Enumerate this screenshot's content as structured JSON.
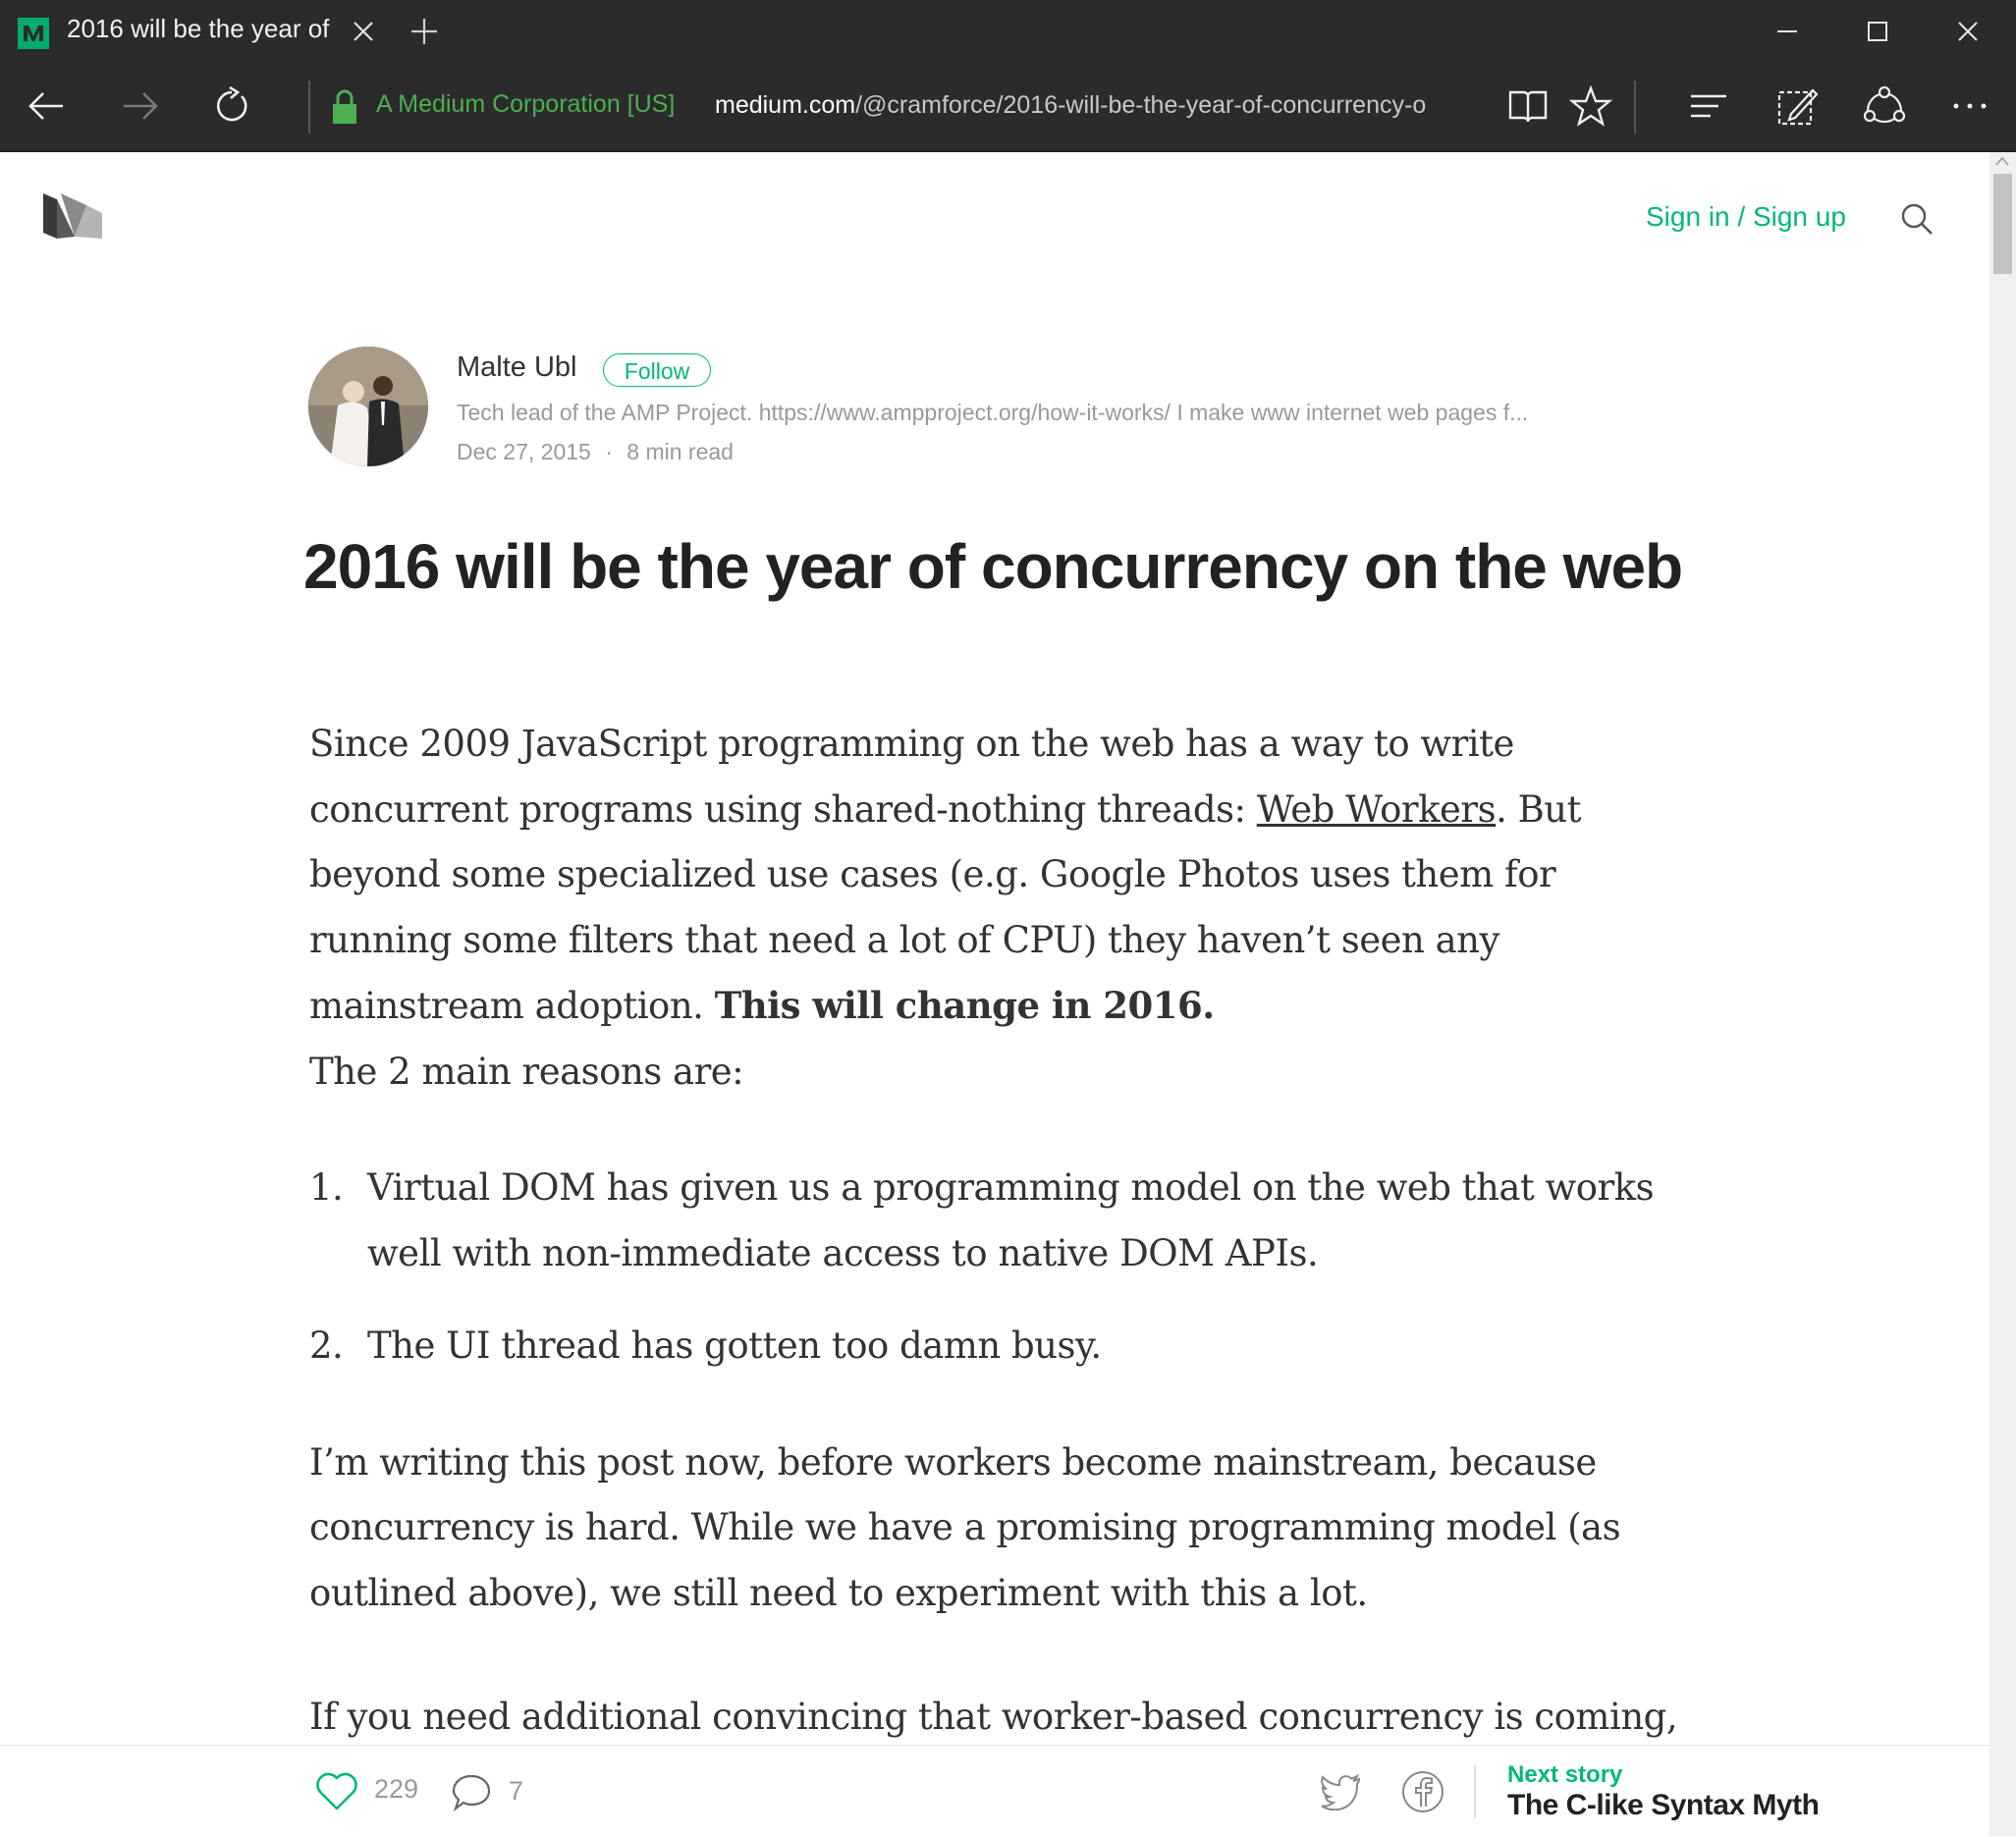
{
  "browser": {
    "tab_title": "2016 will be the year of",
    "cert_name": "A Medium Corporation [US]",
    "url_host": "medium.com",
    "url_path": "/@cramforce/2016-will-be-the-year-of-concurrency-o",
    "accent_green": "#4caf50"
  },
  "site": {
    "signin_label": "Sign in / Sign up",
    "brand_color": "#02b875"
  },
  "author": {
    "name": "Malte Ubl",
    "follow_label": "Follow",
    "bio": "Tech lead of the AMP Project. https://www.ampproject.org/how-it-works/ I make www internet web pages f...",
    "date": "Dec 27, 2015",
    "separator": "·",
    "read_time": "8 min read"
  },
  "post": {
    "title": "2016 will be the year of concurrency on the web",
    "p1_start": "Since 2009 JavaScript programming on the web has a way to write concurrent programs using shared-nothing threads: ",
    "p1_link": "Web Workers",
    "p1_mid": ". But beyond some specialized use cases (e.g. Google Photos uses them for running some filters that need a lot of CPU) they haven’t seen any mainstream adoption. ",
    "p1_bold": "This will change in 2016.",
    "p2": "The 2 main reasons are:",
    "list": [
      {
        "num": "1.",
        "text": "Virtual DOM has given us a programming model on the web that works well with non-immediate access to native DOM APIs."
      },
      {
        "num": "2.",
        "text": "The UI thread has gotten too damn busy."
      }
    ],
    "p3": "I’m writing this post now, before workers become mainstream, because concurrency is hard. While we have a promising programming model (as outlined above), we still need to experiment with this a lot.",
    "p4": "If you need additional convincing that worker-based concurrency is coming,"
  },
  "action_bar": {
    "like_count": "229",
    "comment_count": "7",
    "next_label": "Next story",
    "next_title": "The C-like Syntax Myth"
  }
}
